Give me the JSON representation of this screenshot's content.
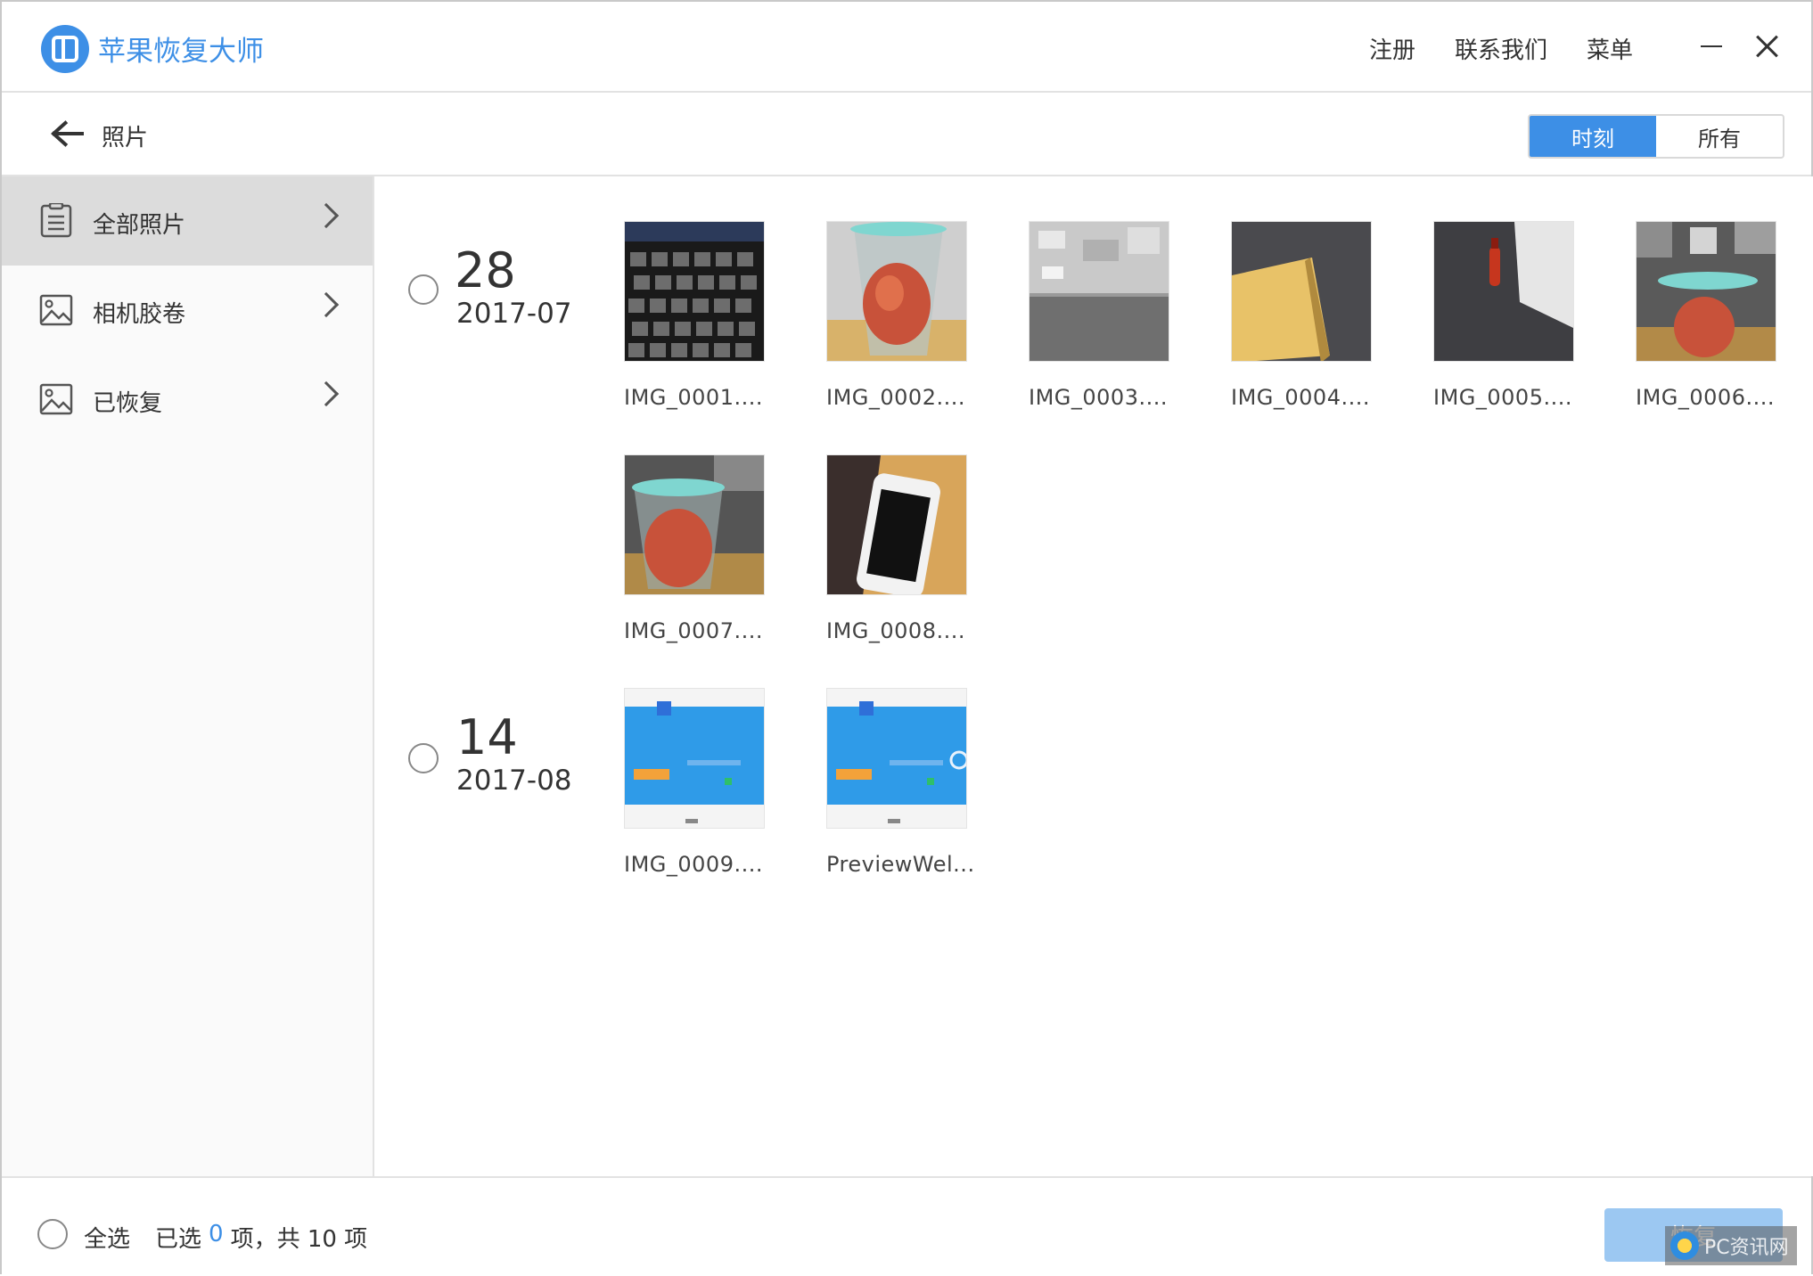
{
  "app": {
    "title": "苹果恢复大师",
    "logo_icon": "app-logo-icon",
    "accent": "#3d8fe6"
  },
  "top_links": [
    "注册",
    "联系我们",
    "菜单"
  ],
  "header": {
    "page_title": "照片",
    "segments": [
      {
        "label": "时刻",
        "active": true
      },
      {
        "label": "所有",
        "active": false
      }
    ]
  },
  "sidebar": {
    "items": [
      {
        "label": "全部照片",
        "icon": "document-list-icon",
        "active": true
      },
      {
        "label": "相机胶卷",
        "icon": "image-icon",
        "active": false
      },
      {
        "label": "已恢复",
        "icon": "image-icon",
        "active": false
      }
    ]
  },
  "groups": [
    {
      "day": "28",
      "month": "2017-07",
      "photos": [
        {
          "name": "IMG_0001....",
          "kind": "keyboard"
        },
        {
          "name": "IMG_0002....",
          "kind": "cup"
        },
        {
          "name": "IMG_0003....",
          "kind": "room"
        },
        {
          "name": "IMG_0004....",
          "kind": "floor-yellow"
        },
        {
          "name": "IMG_0005....",
          "kind": "corner-red"
        },
        {
          "name": "IMG_0006....",
          "kind": "cup-blur"
        },
        {
          "name": "IMG_0007....",
          "kind": "cup"
        },
        {
          "name": "IMG_0008....",
          "kind": "phone"
        }
      ]
    },
    {
      "day": "14",
      "month": "2017-08",
      "photos": [
        {
          "name": "IMG_0009....",
          "kind": "screenshot"
        },
        {
          "name": "PreviewWel...",
          "kind": "screenshot"
        }
      ]
    }
  ],
  "footer": {
    "select_all": "全选",
    "selected_prefix": "已选",
    "selected_count": "0",
    "selected_suffix": "项，共 10 项",
    "recover_label": "恢复",
    "watermark_text": "PC资讯网"
  }
}
